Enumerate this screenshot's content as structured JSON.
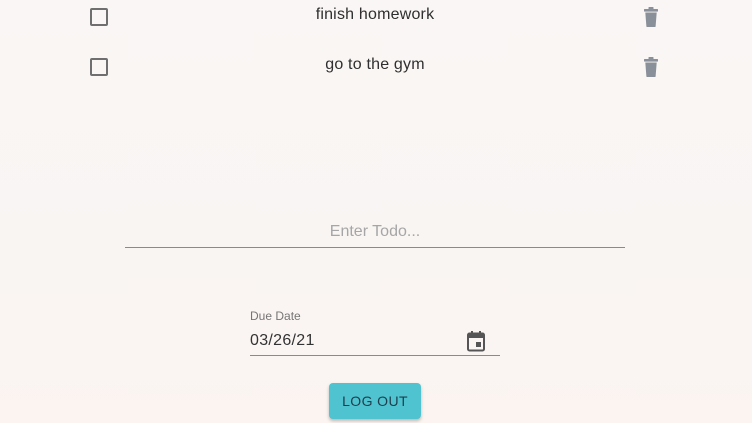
{
  "todos": [
    {
      "text": "finish homework",
      "checked": false
    },
    {
      "text": "go to the gym",
      "checked": false
    }
  ],
  "new_todo": {
    "placeholder": "Enter Todo...",
    "value": ""
  },
  "due_date": {
    "label": "Due Date",
    "value": "03/26/21"
  },
  "logout_button": {
    "label": "LOG OUT"
  },
  "colors": {
    "accent": "#4fc3cf",
    "icon_gray": "#8a9099"
  },
  "icons": {
    "delete": "trash-icon",
    "calendar": "calendar-icon"
  }
}
